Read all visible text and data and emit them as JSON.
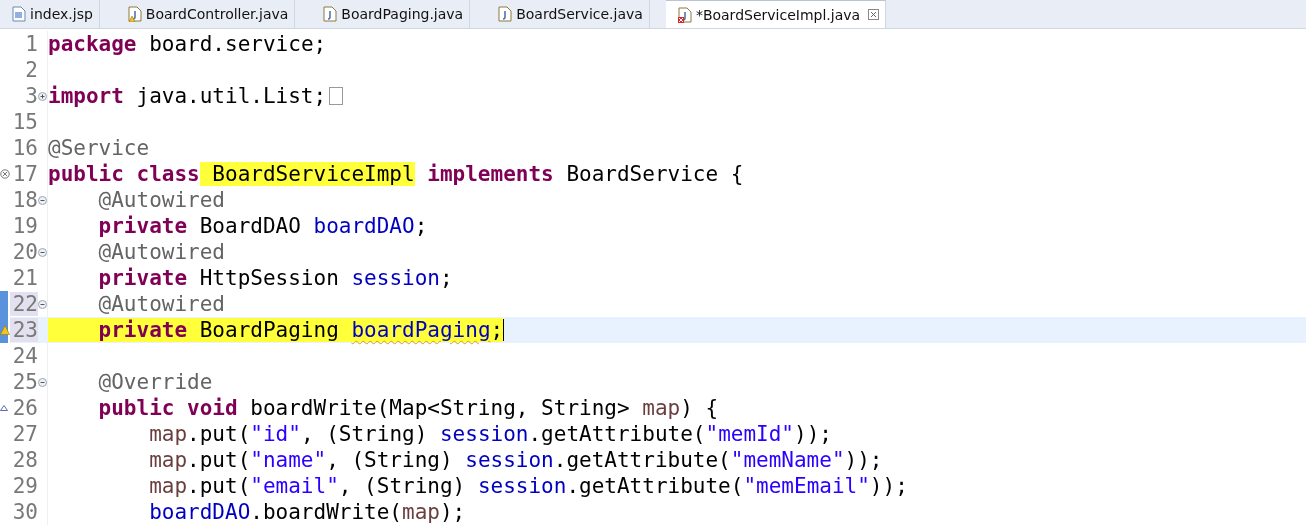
{
  "tabs": [
    {
      "label": "index.jsp",
      "kind": "jsp",
      "selected": false
    },
    {
      "label": "BoardController.java",
      "kind": "java-warning",
      "selected": false
    },
    {
      "label": "BoardPaging.java",
      "kind": "java",
      "selected": false
    },
    {
      "label": "BoardService.java",
      "kind": "java",
      "selected": false
    },
    {
      "label": "*BoardServiceImpl.java",
      "kind": "java-error",
      "selected": true
    }
  ],
  "lines": [
    {
      "number": "1",
      "tokens": [
        {
          "t": "package",
          "kind": "kw"
        },
        {
          "t": " board.service;",
          "kind": "plain"
        }
      ]
    },
    {
      "number": "2"
    },
    {
      "number": "3",
      "fold_icon": {
        "kind": "expand"
      },
      "folded": true,
      "tokens": [
        {
          "t": "import",
          "kind": "kw"
        },
        {
          "t": " java.util.List;",
          "kind": "plain"
        }
      ]
    },
    {
      "number": "15"
    },
    {
      "number": "16",
      "tokens": [
        {
          "t": "@Service",
          "kind": "ann"
        }
      ]
    },
    {
      "number": "17",
      "ruler_icon": {
        "kind": "error"
      },
      "tokens": [
        {
          "t": "public",
          "kind": "kw"
        },
        {
          "t": " class",
          "kind": "kw"
        },
        {
          "t": " BoardServiceImpl",
          "kind": "plain",
          "highlight": true
        },
        {
          "t": " implements",
          "kind": "kw"
        },
        {
          "t": " BoardService {",
          "kind": "plain"
        }
      ]
    },
    {
      "number": "18",
      "fold_icon": {
        "kind": "collapse"
      },
      "tokens": [
        {
          "t": "    @Autowired",
          "kind": "ann"
        }
      ]
    },
    {
      "number": "19",
      "tokens": [
        {
          "t": "    private",
          "kind": "kw"
        },
        {
          "t": " BoardDAO ",
          "kind": "plain"
        },
        {
          "t": "boardDAO",
          "kind": "field"
        },
        {
          "t": ";",
          "kind": "plain"
        }
      ]
    },
    {
      "number": "20",
      "fold_icon": {
        "kind": "collapse"
      },
      "tokens": [
        {
          "t": "    @Autowired",
          "kind": "ann"
        }
      ]
    },
    {
      "number": "21",
      "tokens": [
        {
          "t": "    private",
          "kind": "kw"
        },
        {
          "t": " HttpSession ",
          "kind": "plain"
        },
        {
          "t": "session",
          "kind": "field"
        },
        {
          "t": ";",
          "kind": "plain"
        }
      ]
    },
    {
      "number": "22",
      "fold_icon": {
        "kind": "collapse"
      },
      "changed": true,
      "tokens": [
        {
          "t": "    @Autowired",
          "kind": "ann"
        }
      ]
    },
    {
      "number": "23",
      "ruler_icon": {
        "kind": "warning"
      },
      "changed": true,
      "current": true,
      "caret": true,
      "tokens": [
        {
          "t": "    private",
          "kind": "kw",
          "highlight": true
        },
        {
          "t": " BoardPaging ",
          "kind": "plain",
          "highlight": true
        },
        {
          "t": "boardPaging",
          "kind": "field",
          "highlight": true,
          "squiggle": true
        },
        {
          "t": ";",
          "kind": "plain",
          "highlight": true
        }
      ]
    },
    {
      "number": "24"
    },
    {
      "number": "25",
      "fold_icon": {
        "kind": "collapse"
      },
      "tokens": [
        {
          "t": "    @Override",
          "kind": "ann"
        }
      ]
    },
    {
      "number": "26",
      "ruler_icon": {
        "kind": "override"
      },
      "tokens": [
        {
          "t": "    public",
          "kind": "kw"
        },
        {
          "t": " void",
          "kind": "kw"
        },
        {
          "t": " boardWrite(Map<String, String> ",
          "kind": "plain"
        },
        {
          "t": "map",
          "kind": "param"
        },
        {
          "t": ") {",
          "kind": "plain"
        }
      ]
    },
    {
      "number": "27",
      "tokens": [
        {
          "t": "        map",
          "kind": "param"
        },
        {
          "t": ".put(",
          "kind": "plain"
        },
        {
          "t": "\"id\"",
          "kind": "str"
        },
        {
          "t": ", (String) ",
          "kind": "plain"
        },
        {
          "t": "session",
          "kind": "field"
        },
        {
          "t": ".getAttribute(",
          "kind": "plain"
        },
        {
          "t": "\"memId\"",
          "kind": "str"
        },
        {
          "t": "));",
          "kind": "plain"
        }
      ]
    },
    {
      "number": "28",
      "tokens": [
        {
          "t": "        map",
          "kind": "param"
        },
        {
          "t": ".put(",
          "kind": "plain"
        },
        {
          "t": "\"name\"",
          "kind": "str"
        },
        {
          "t": ", (String) ",
          "kind": "plain"
        },
        {
          "t": "session",
          "kind": "field"
        },
        {
          "t": ".getAttribute(",
          "kind": "plain"
        },
        {
          "t": "\"memName\"",
          "kind": "str"
        },
        {
          "t": "));",
          "kind": "plain"
        }
      ]
    },
    {
      "number": "29",
      "tokens": [
        {
          "t": "        map",
          "kind": "param"
        },
        {
          "t": ".put(",
          "kind": "plain"
        },
        {
          "t": "\"email\"",
          "kind": "str"
        },
        {
          "t": ", (String) ",
          "kind": "plain"
        },
        {
          "t": "session",
          "kind": "field"
        },
        {
          "t": ".getAttribute(",
          "kind": "plain"
        },
        {
          "t": "\"memEmail\"",
          "kind": "str"
        },
        {
          "t": "));",
          "kind": "plain"
        }
      ]
    },
    {
      "number": "30",
      "tokens": [
        {
          "t": "        boardDAO",
          "kind": "field"
        },
        {
          "t": ".boardWrite(",
          "kind": "plain"
        },
        {
          "t": "map",
          "kind": "param"
        },
        {
          "t": ");",
          "kind": "plain"
        }
      ]
    }
  ]
}
